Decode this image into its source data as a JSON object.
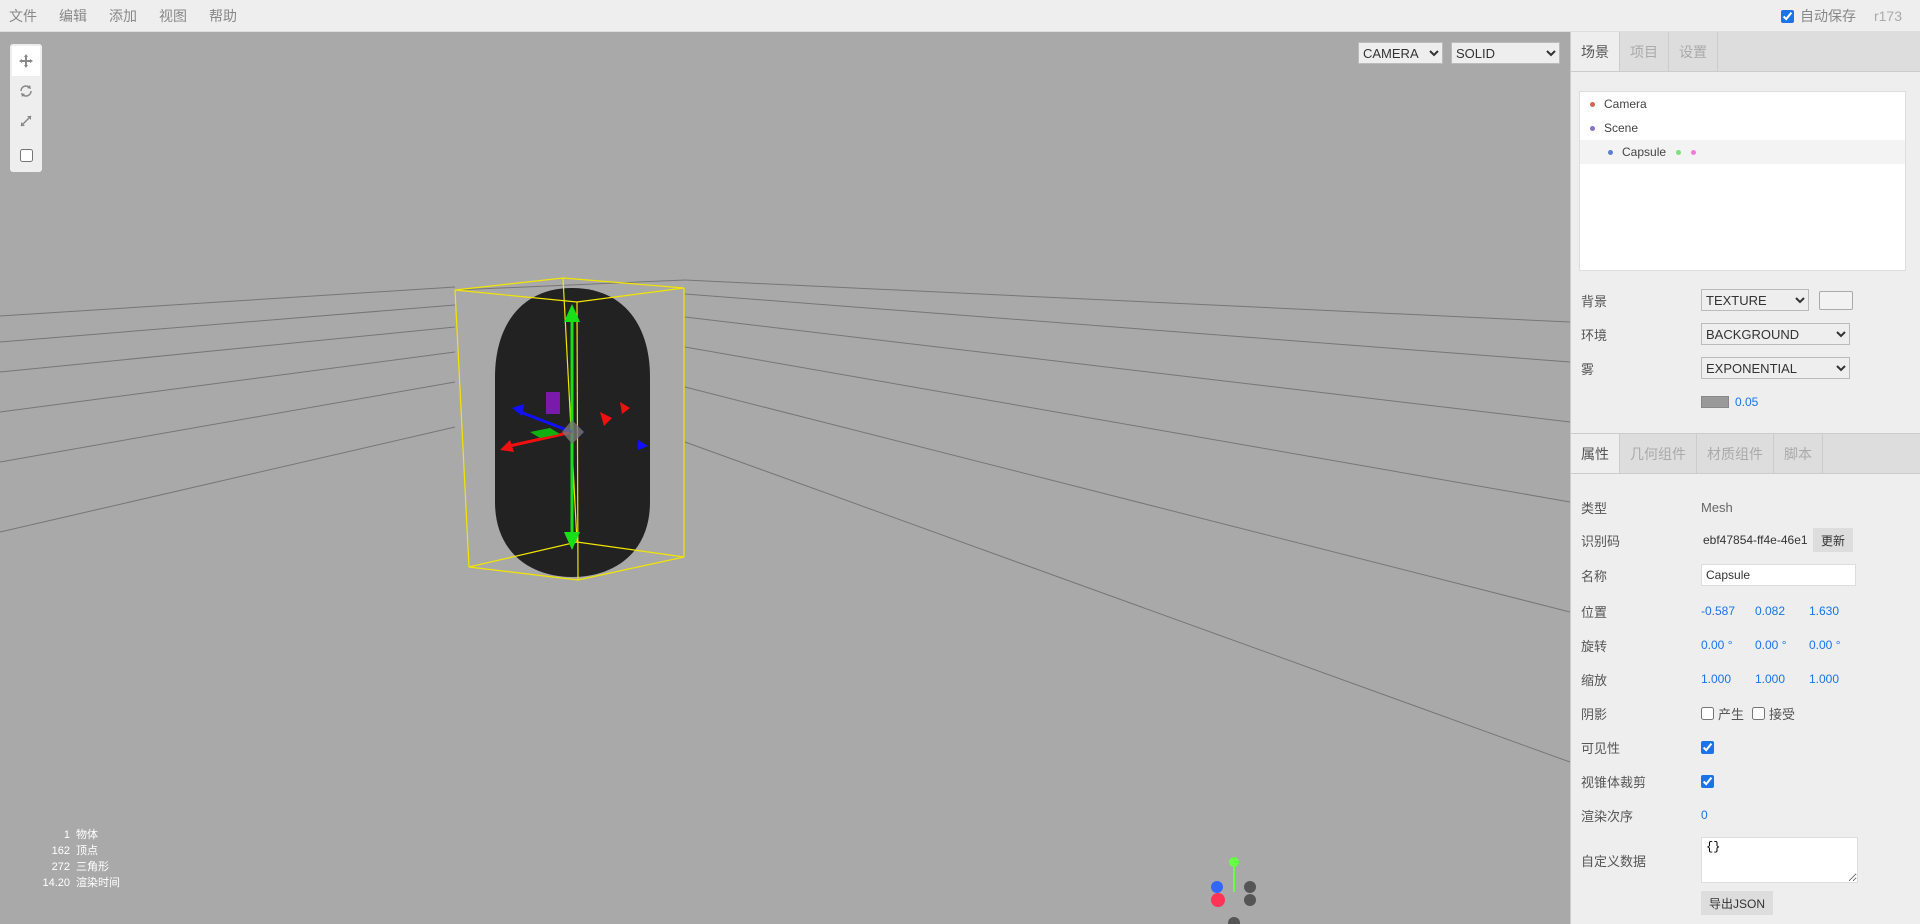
{
  "menubar": {
    "items": [
      "文件",
      "编辑",
      "添加",
      "视图",
      "帮助"
    ],
    "autosave_label": "自动保存",
    "version": "r173"
  },
  "viewport": {
    "camera_select": "CAMERA",
    "shading_select": "SOLID",
    "info": [
      {
        "value": "1",
        "label": "物体"
      },
      {
        "value": "162",
        "label": "顶点"
      },
      {
        "value": "272",
        "label": "三角形"
      },
      {
        "value": "14.20",
        "label": "渲染时间"
      }
    ]
  },
  "sidebar": {
    "tabs": [
      "场景",
      "项目",
      "设置"
    ],
    "outliner": [
      {
        "name": "Camera",
        "color": "#d1665a"
      },
      {
        "name": "Scene",
        "color": "#8773c4"
      },
      {
        "name": "Capsule",
        "color": "#5a7fd1"
      }
    ],
    "background_label": "背景",
    "background_value": "TEXTURE",
    "environment_label": "环境",
    "environment_value": "BACKGROUND",
    "fog_label": "雾",
    "fog_value": "EXPONENTIAL",
    "fog_density": "0.05",
    "prop_tabs": [
      "属性",
      "几何组件",
      "材质组件",
      "脚本"
    ],
    "object": {
      "type_label": "类型",
      "type_value": "Mesh",
      "uuid_label": "识别码",
      "uuid_value": "ebf47854-ff4e-46e1",
      "uuid_button": "更新",
      "name_label": "名称",
      "name_value": "Capsule",
      "position_label": "位置",
      "position": [
        "-0.587",
        "0.082",
        "1.630"
      ],
      "rotation_label": "旋转",
      "rotation": [
        "0.00 °",
        "0.00 °",
        "0.00 °"
      ],
      "scale_label": "缩放",
      "scale": [
        "1.000",
        "1.000",
        "1.000"
      ],
      "shadow_label": "阴影",
      "shadow_cast": "产生",
      "shadow_receive": "接受",
      "visible_label": "可见性",
      "frustum_label": "视锥体裁剪",
      "render_order_label": "渲染次序",
      "render_order": "0",
      "userdata_label": "自定义数据",
      "userdata": "{}",
      "export_button": "导出JSON"
    }
  }
}
